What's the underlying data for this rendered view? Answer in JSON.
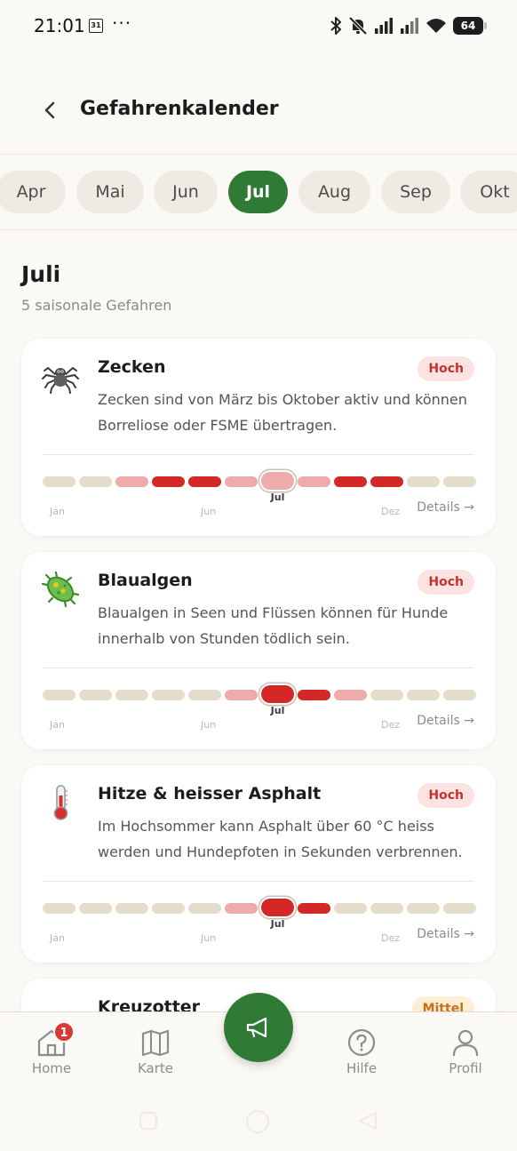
{
  "status_bar": {
    "time": "21:01",
    "calendar_day": "31",
    "more": "···",
    "battery": "64"
  },
  "header": {
    "title": "Gefahrenkalender",
    "back_icon": "chevron-left-icon"
  },
  "months": {
    "items": [
      "Apr",
      "Mai",
      "Jun",
      "Jul",
      "Aug",
      "Sep",
      "Okt"
    ],
    "selected": "Jul"
  },
  "section": {
    "title": "Juli",
    "subtitle": "5 saisonale Gefahren"
  },
  "timeline_axis": {
    "start": "Jan",
    "mid": "Jun",
    "end": "Dez",
    "current": "Jul"
  },
  "details_label": "Details →",
  "colors": {
    "accent": "#2f7a35",
    "high": "#d42828",
    "medium": "#eeabab",
    "low": "#e5ddcb",
    "badge_high_text": "#c5332d",
    "badge_medium_text": "#c8701a"
  },
  "hazards": [
    {
      "icon": "spider-icon",
      "title": "Zecken",
      "badge": "Hoch",
      "level": "hoch",
      "description": "Zecken sind von März bis Oktober aktiv und können Borreliose oder FSME übertragen.",
      "months_risk": [
        0,
        0,
        1,
        2,
        2,
        1,
        1,
        1,
        2,
        2,
        0,
        0
      ]
    },
    {
      "icon": "microbe-icon",
      "title": "Blaualgen",
      "badge": "Hoch",
      "level": "hoch",
      "description": "Blaualgen in Seen und Flüssen können für Hunde innerhalb von Stunden tödlich sein.",
      "months_risk": [
        0,
        0,
        0,
        0,
        0,
        1,
        2,
        2,
        1,
        0,
        0,
        0
      ]
    },
    {
      "icon": "thermometer-icon",
      "title": "Hitze & heisser Asphalt",
      "badge": "Hoch",
      "level": "hoch",
      "description": "Im Hochsommer kann Asphalt über 60 °C heiss werden und Hundepfoten in Sekunden verbrennen.",
      "months_risk": [
        0,
        0,
        0,
        0,
        0,
        1,
        2,
        2,
        0,
        0,
        0,
        0
      ]
    },
    {
      "icon": "snake-icon",
      "title": "Kreuzotter",
      "badge": "Mittel",
      "level": "mittel"
    }
  ],
  "bottom_nav": {
    "items": [
      {
        "label": "Home",
        "icon": "home-icon",
        "badge": "1"
      },
      {
        "label": "Karte",
        "icon": "map-icon"
      },
      {
        "label": "Hilfe",
        "icon": "help-icon"
      },
      {
        "label": "Profil",
        "icon": "profile-icon"
      }
    ],
    "fab_icon": "megaphone-icon"
  }
}
